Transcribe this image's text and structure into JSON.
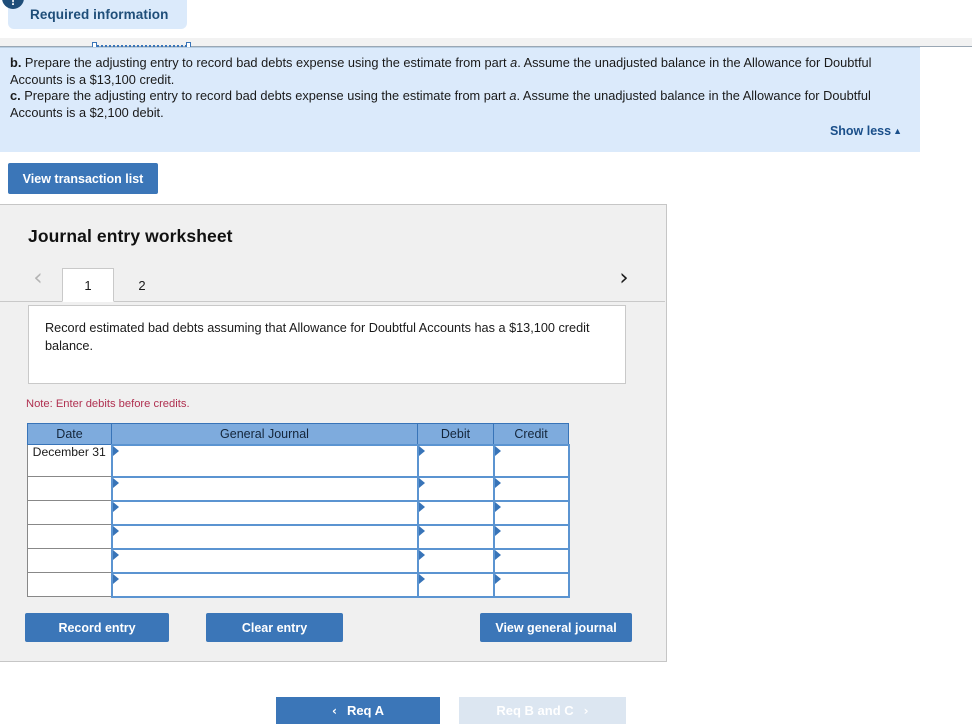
{
  "header": {
    "required_info_label": "Required information",
    "alert_icon_glyph": "!"
  },
  "instructions": {
    "items": [
      {
        "letter": "b.",
        "text_before_italic": " Prepare the adjusting entry to record bad debts expense using the estimate from part ",
        "italic": "a",
        "text_after_italic": ". Assume the unadjusted balance in the Allowance for Doubtful Accounts is a $13,100 credit."
      },
      {
        "letter": "c.",
        "text_before_italic": " Prepare the adjusting entry to record bad debts expense using the estimate from part ",
        "italic": "a",
        "text_after_italic": ". Assume the unadjusted balance in the Allowance for Doubtful Accounts is a $2,100 debit."
      }
    ],
    "show_less_label": "Show less",
    "show_less_caret": "▲"
  },
  "toolbar": {
    "view_transaction_list_label": "View transaction list"
  },
  "worksheet": {
    "title": "Journal entry worksheet",
    "prev_chevron": "‹",
    "next_chevron": "›",
    "tabs": [
      {
        "label": "1",
        "active": true
      },
      {
        "label": "2",
        "active": false
      }
    ],
    "requirement_text": "Record estimated bad debts assuming that Allowance for Doubtful Accounts has a $13,100 credit balance.",
    "note": "Note: Enter debits before credits.",
    "table": {
      "columns": [
        "Date",
        "General Journal",
        "Debit",
        "Credit"
      ],
      "rows": [
        {
          "date": "December 31",
          "general_journal": "",
          "debit": "",
          "credit": ""
        },
        {
          "date": "",
          "general_journal": "",
          "debit": "",
          "credit": ""
        },
        {
          "date": "",
          "general_journal": "",
          "debit": "",
          "credit": ""
        },
        {
          "date": "",
          "general_journal": "",
          "debit": "",
          "credit": ""
        },
        {
          "date": "",
          "general_journal": "",
          "debit": "",
          "credit": ""
        },
        {
          "date": "",
          "general_journal": "",
          "debit": "",
          "credit": ""
        }
      ]
    },
    "actions": {
      "record_entry_label": "Record entry",
      "clear_entry_label": "Clear entry",
      "view_general_journal_label": "View general journal"
    }
  },
  "bottom_nav": {
    "prev_label": "Req A",
    "prev_arrow": "‹",
    "next_label": "Req B and C",
    "next_arrow": "›"
  },
  "colors": {
    "primary_blue": "#3b76b8",
    "panel_blue": "#dbeafb",
    "table_header_blue": "#7eabdd",
    "cell_border_blue": "#5b94d1",
    "note_red": "#b03050",
    "disabled_blue": "#dce6f1"
  }
}
